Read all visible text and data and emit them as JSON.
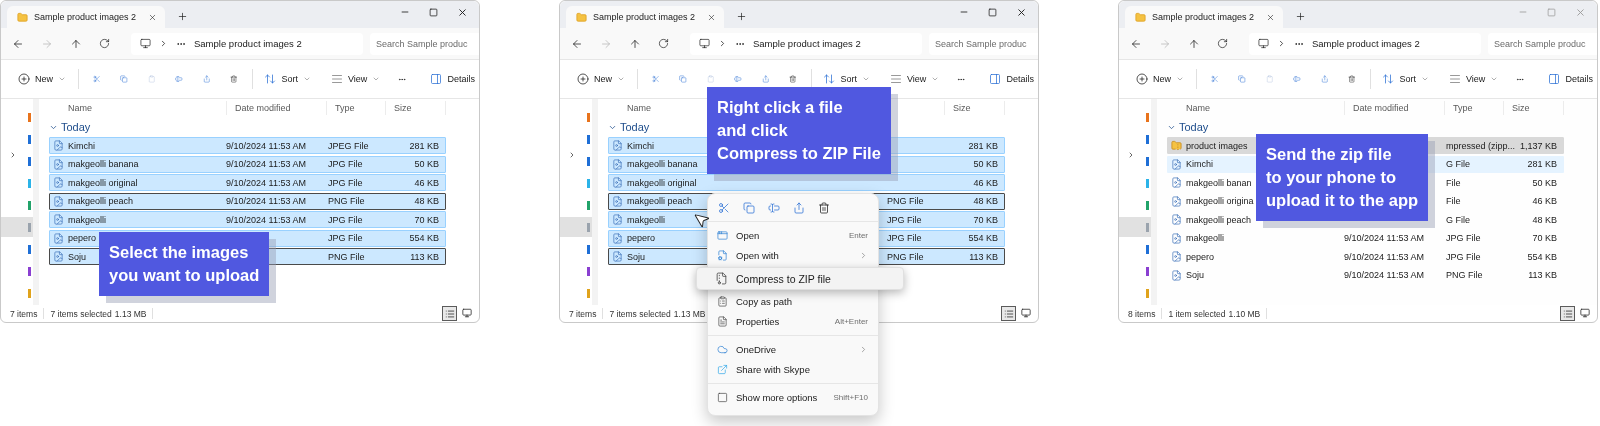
{
  "windows": [
    {
      "active": true,
      "tab_title": "Sample product images 2",
      "breadcrumb": "Sample product images 2",
      "search_placeholder": "Search Sample produc",
      "toolbar": {
        "new": "New",
        "sort": "Sort",
        "view": "View",
        "details": "Details"
      },
      "columns": {
        "name": "Name",
        "date": "Date modified",
        "type": "Type",
        "size": "Size"
      },
      "group": "Today",
      "rows": [
        {
          "kind": "image",
          "name": "Kimchi",
          "date": "9/10/2024 11:53 AM",
          "type": "JPEG File",
          "size": "281 KB",
          "selected": true,
          "focused": false,
          "hovered": false
        },
        {
          "kind": "image",
          "name": "makgeolli banana",
          "date": "9/10/2024 11:53 AM",
          "type": "JPG File",
          "size": "50 KB",
          "selected": true,
          "focused": false,
          "hovered": false
        },
        {
          "kind": "image",
          "name": "makgeolli original",
          "date": "9/10/2024 11:53 AM",
          "type": "JPG File",
          "size": "46 KB",
          "selected": true,
          "focused": false,
          "hovered": false
        },
        {
          "kind": "image",
          "name": "makgeolli peach",
          "date": "9/10/2024 11:53 AM",
          "type": "PNG File",
          "size": "48 KB",
          "selected": true,
          "focused": true,
          "hovered": false
        },
        {
          "kind": "image",
          "name": "makgeolli",
          "date": "9/10/2024 11:53 AM",
          "type": "JPG File",
          "size": "70 KB",
          "selected": true,
          "focused": false,
          "hovered": false
        },
        {
          "kind": "image",
          "name": "pepero",
          "type": "JPG File",
          "size": "554 KB",
          "selected": true,
          "focused": false,
          "hovered": false
        },
        {
          "kind": "image",
          "name": "Soju",
          "type": "PNG File",
          "size": "113 KB",
          "selected": true,
          "focused": true,
          "hovered": false
        }
      ],
      "status": {
        "count": "7 items",
        "selection": "7 items selected",
        "size": "1.13 MB"
      },
      "callout": [
        "Select the images",
        "you want to upload"
      ]
    },
    {
      "active": true,
      "tab_title": "Sample product images 2",
      "breadcrumb": "Sample product images 2",
      "search_placeholder": "Search Sample produc",
      "toolbar": {
        "new": "New",
        "sort": "Sort",
        "view": "View",
        "details": "Details"
      },
      "columns": {
        "name": "Name",
        "size": "Size"
      },
      "group": "Today",
      "rows": [
        {
          "kind": "image",
          "name": "Kimchi",
          "size": "281 KB",
          "selected": true,
          "focused": false,
          "hovered": false
        },
        {
          "kind": "image",
          "name": "makgeolli banana",
          "size": "50 KB",
          "selected": true,
          "focused": false,
          "hovered": false
        },
        {
          "kind": "image",
          "name": "makgeolli original",
          "size": "46 KB",
          "selected": true,
          "focused": false,
          "hovered": false
        },
        {
          "kind": "image",
          "name": "makgeolli peach",
          "type": "PNG File",
          "size": "48 KB",
          "selected": true,
          "focused": true,
          "hovered": false
        },
        {
          "kind": "image",
          "name": "makgeolli",
          "type": "JPG File",
          "size": "70 KB",
          "selected": true,
          "focused": false,
          "hovered": false
        },
        {
          "kind": "image",
          "name": "pepero",
          "type": "JPG File",
          "size": "554 KB",
          "selected": true,
          "focused": false,
          "hovered": false
        },
        {
          "kind": "image",
          "name": "Soju",
          "type": "PNG File",
          "size": "113 KB",
          "selected": true,
          "focused": true,
          "hovered": false
        }
      ],
      "status": {
        "count": "7 items",
        "selection": "7 items selected",
        "size": "1.13 MB"
      },
      "callout": [
        "Right click a file",
        "and click",
        "Compress to ZIP File"
      ],
      "context_menu": {
        "groups": [
          [
            {
              "label": "Open",
              "shortcut": "Enter",
              "submenu": false,
              "highlighted": false
            },
            {
              "label": "Open with",
              "submenu": true,
              "highlighted": false
            },
            {
              "label": "Compress to ZIP file",
              "submenu": false,
              "highlighted": true
            },
            {
              "label": "Copy as path",
              "submenu": false,
              "highlighted": false
            },
            {
              "label": "Properties",
              "shortcut": "Alt+Enter",
              "submenu": false,
              "highlighted": false
            }
          ],
          [
            {
              "label": "OneDrive",
              "submenu": true,
              "highlighted": false
            },
            {
              "label": "Share with Skype",
              "submenu": false,
              "highlighted": false
            }
          ],
          [
            {
              "label": "Show more options",
              "shortcut": "Shift+F10",
              "submenu": false,
              "highlighted": false
            }
          ]
        ]
      }
    },
    {
      "active": false,
      "tab_title": "Sample product images 2",
      "breadcrumb": "Sample product images 2",
      "search_placeholder": "Search Sample produc",
      "toolbar": {
        "new": "New",
        "sort": "Sort",
        "view": "View",
        "details": "Details"
      },
      "columns": {
        "name": "Name",
        "date": "Date modified",
        "type": "Type",
        "size": "Size"
      },
      "group": "Today",
      "rows": [
        {
          "kind": "zip",
          "name": "product images",
          "type": "mpressed (zipp...",
          "size": "1,137 KB",
          "selected": true,
          "focused": false,
          "hovered": false
        },
        {
          "kind": "image",
          "name": "Kimchi",
          "type": "G File",
          "size": "281 KB",
          "selected": false,
          "focused": false,
          "hovered": true
        },
        {
          "kind": "image",
          "name": "makgeolli banan",
          "type": "File",
          "size": "50 KB",
          "selected": false,
          "focused": false,
          "hovered": false
        },
        {
          "kind": "image",
          "name": "makgeolli origina",
          "type": "File",
          "size": "46 KB",
          "selected": false,
          "focused": false,
          "hovered": false
        },
        {
          "kind": "image",
          "name": "makgeolli peach",
          "type": "G File",
          "size": "48 KB",
          "selected": false,
          "focused": false,
          "hovered": false
        },
        {
          "kind": "image",
          "name": "makgeolli",
          "date": "9/10/2024 11:53 AM",
          "type": "JPG File",
          "size": "70 KB",
          "selected": false,
          "focused": false,
          "hovered": false
        },
        {
          "kind": "image",
          "name": "pepero",
          "date": "9/10/2024 11:53 AM",
          "type": "JPG File",
          "size": "554 KB",
          "selected": false,
          "focused": false,
          "hovered": false
        },
        {
          "kind": "image",
          "name": "Soju",
          "date": "9/10/2024 11:53 AM",
          "type": "PNG File",
          "size": "113 KB",
          "selected": false,
          "focused": false,
          "hovered": false
        }
      ],
      "status": {
        "count": "8 items",
        "selection": "1 item selected",
        "size": "1.10 MB"
      },
      "callout": [
        "Send the zip file",
        "to your phone to",
        "upload it to the app"
      ]
    }
  ]
}
